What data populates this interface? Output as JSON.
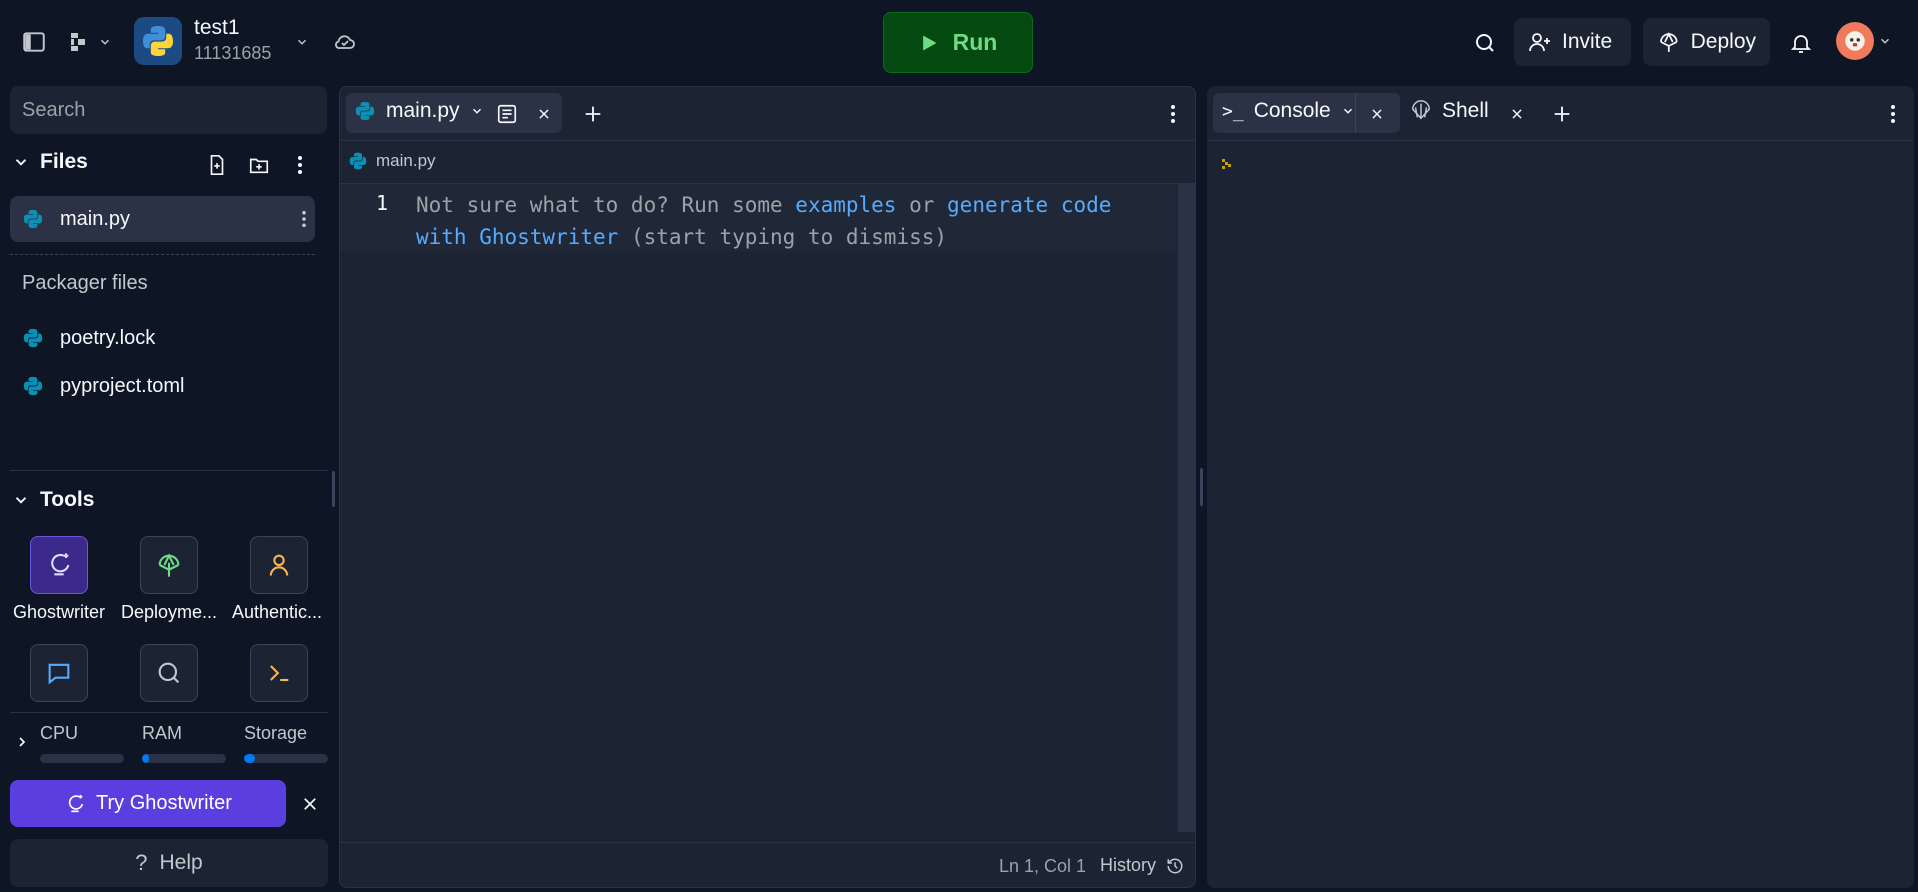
{
  "header": {
    "repl_name": "test1",
    "repl_id": "11131685",
    "run_label": "Run",
    "invite_label": "Invite",
    "deploy_label": "Deploy"
  },
  "sidebar": {
    "search_placeholder": "Search",
    "files_title": "Files",
    "files": [
      {
        "name": "main.py"
      }
    ],
    "packager_title": "Packager files",
    "packager_files": [
      {
        "name": "poetry.lock"
      },
      {
        "name": "pyproject.toml"
      }
    ],
    "tools_title": "Tools",
    "tools": [
      {
        "label": "Ghostwriter",
        "icon": "ghostwriter-icon"
      },
      {
        "label": "Deployme...",
        "icon": "deployments-icon"
      },
      {
        "label": "Authentic...",
        "icon": "authentication-icon"
      },
      {
        "label": "",
        "icon": "chat-icon"
      },
      {
        "label": "",
        "icon": "search-icon"
      },
      {
        "label": "",
        "icon": "shell-icon"
      }
    ],
    "resources": {
      "cpu_label": "CPU",
      "ram_label": "RAM",
      "storage_label": "Storage",
      "cpu_fill": 0.0,
      "ram_fill": 0.08,
      "storage_fill": 0.13
    },
    "try_ghostwriter_label": "Try Ghostwriter",
    "help_label": "Help"
  },
  "editor": {
    "tab_label": "main.py",
    "breadcrumb": "main.py",
    "line_number": "1",
    "hint": {
      "part1": "Not sure what to do? Run some ",
      "link1": "examples",
      "part2": " or ",
      "link2a": "generate code",
      "link2b": "with Ghostwriter",
      "part3": " (start typing to dismiss)"
    },
    "cursor_position": "Ln 1, Col 1",
    "history_label": "History"
  },
  "console": {
    "console_tab": "Console",
    "shell_tab": "Shell"
  },
  "colors": {
    "background": "#0e1525",
    "panel": "#1c2333",
    "accent_purple": "#5b3ee0",
    "run_green": "#044a10",
    "link_blue": "#57abff"
  }
}
